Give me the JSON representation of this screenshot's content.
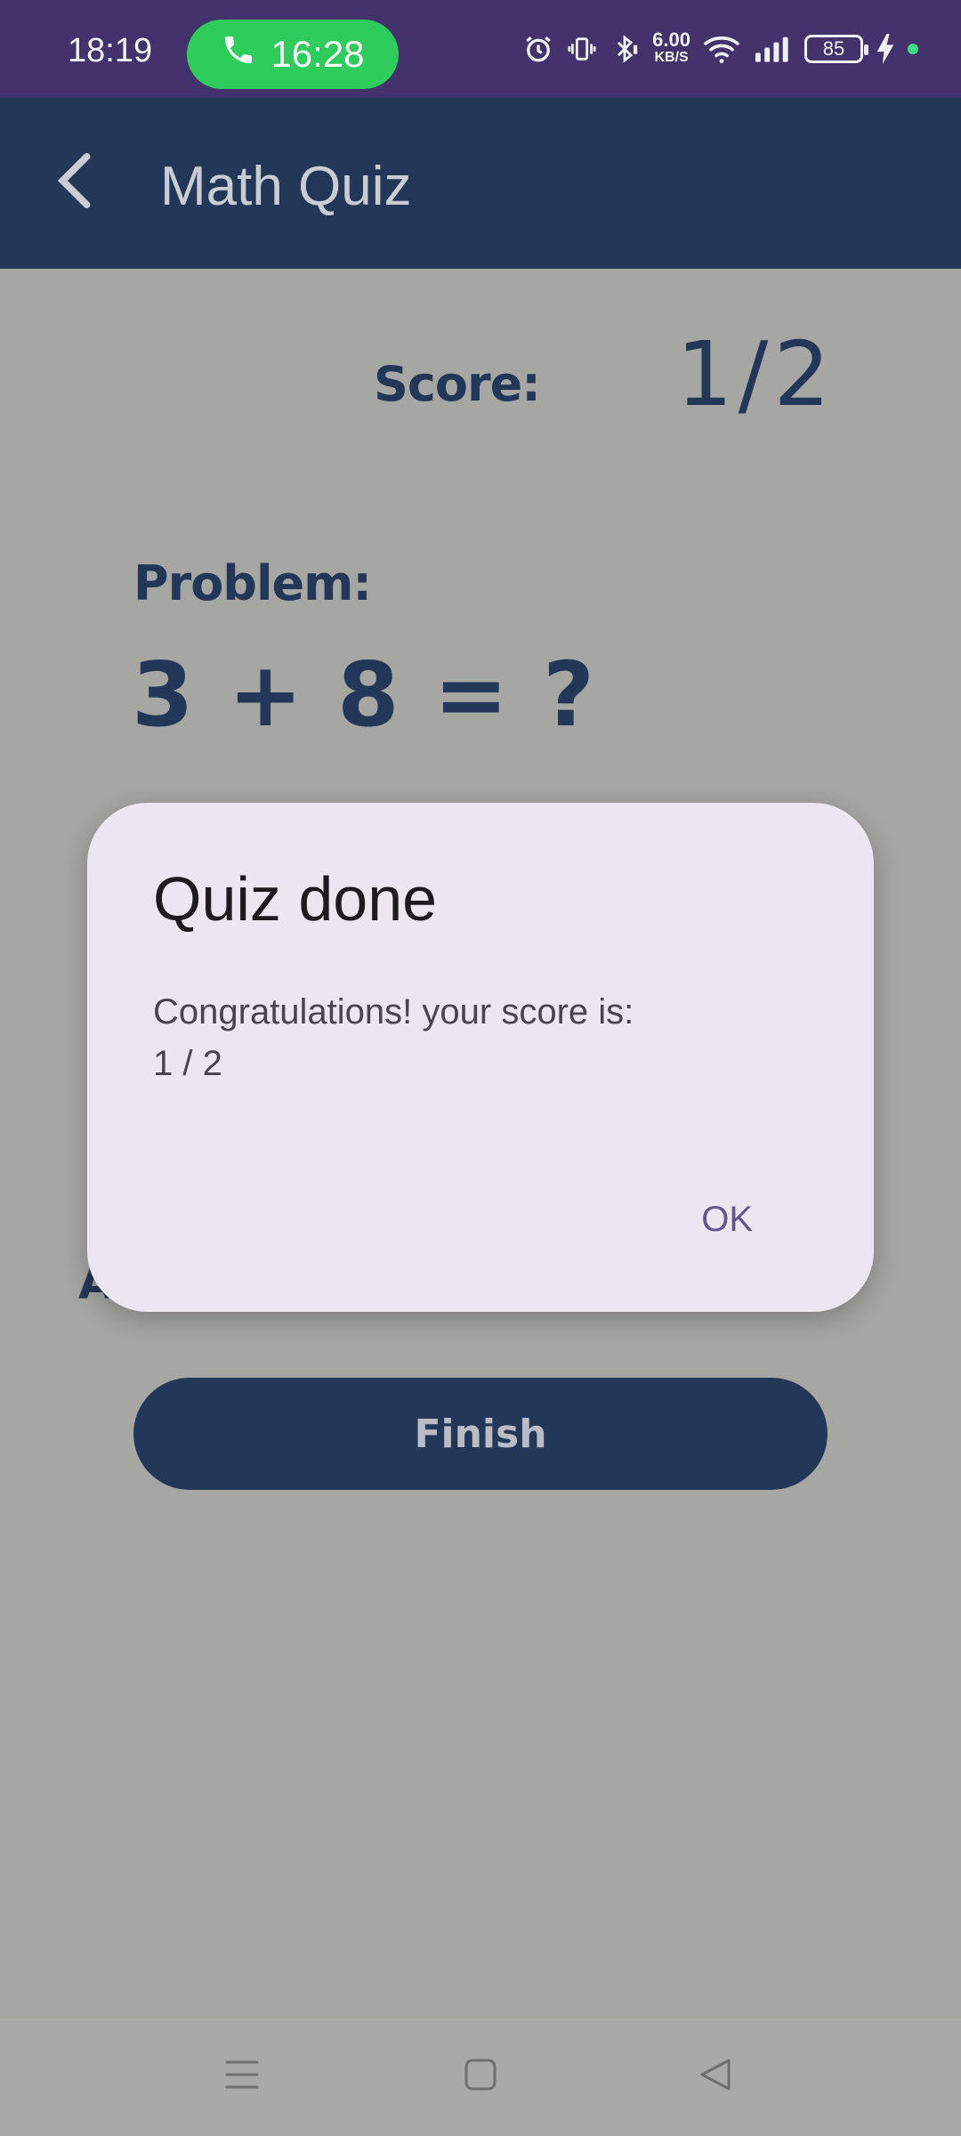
{
  "status_bar": {
    "time": "18:19",
    "call_duration": "16:28",
    "net_speed_value": "6.00",
    "net_speed_unit": "KB/S",
    "battery_level": "85",
    "icons": [
      "alarm-icon",
      "vibrate-icon",
      "bluetooth-icon",
      "wifi-icon",
      "signal-icon",
      "battery-icon",
      "charging-icon"
    ]
  },
  "app_bar": {
    "title": "Math Quiz",
    "back_icon": "chevron-left-icon"
  },
  "quiz": {
    "score_label": "Score:",
    "score_value": "1/2",
    "problem_label": "Problem:",
    "problem_text": "3 + 8 = ?",
    "answer_label_partial": "A",
    "finish_label": "Finish"
  },
  "dialog": {
    "title": "Quiz done",
    "message_line1": "Congratulations! your score is:",
    "message_line2": "1 / 2",
    "ok_label": "OK"
  },
  "nav_bar": {
    "icons": [
      "menu-icon",
      "home-icon",
      "back-icon"
    ]
  },
  "colors": {
    "status_bar": "#43326b",
    "app_bar": "#233858",
    "call_pill": "#2dcc5b",
    "dialog_bg": "#ece6f0",
    "dialog_action": "#65558f",
    "scrim_bg": "#a6a6a2"
  }
}
